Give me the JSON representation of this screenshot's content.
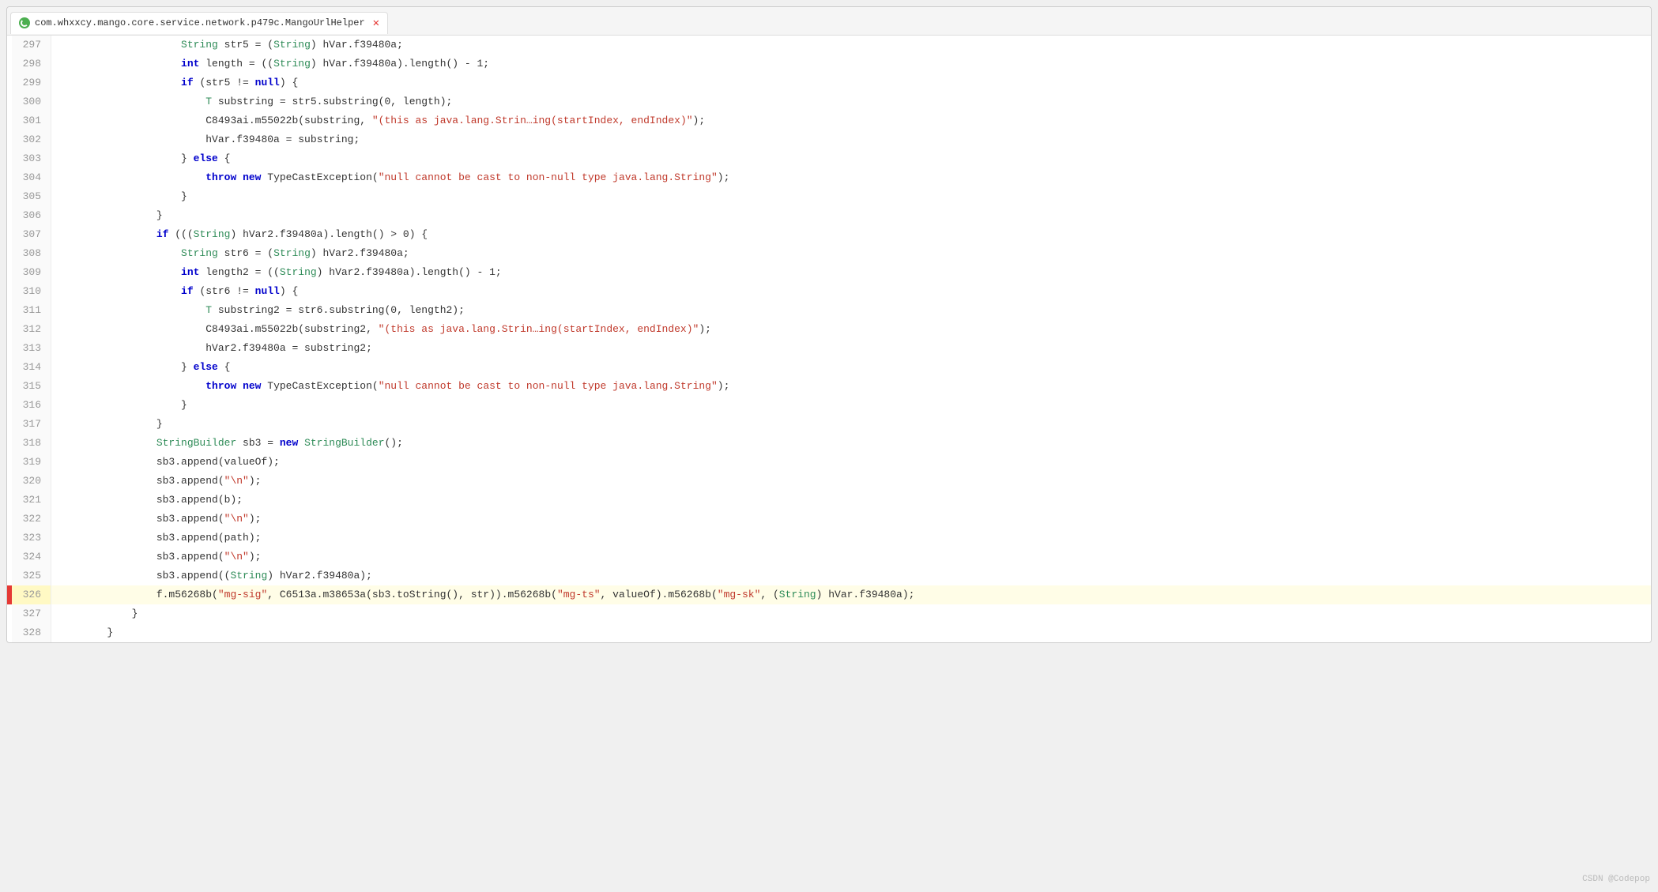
{
  "tab": {
    "icon": "java-icon",
    "label": "com.whxxcy.mango.core.service.network.p479c.MangoUrlHelper",
    "close_label": "✕"
  },
  "lines": [
    {
      "num": "297",
      "indent": 5,
      "tokens": [
        {
          "t": "type",
          "v": "String"
        },
        {
          "t": "var",
          "v": " str5 = ("
        },
        {
          "t": "type",
          "v": "String"
        },
        {
          "t": "var",
          "v": ") hVar.f39480a;"
        }
      ]
    },
    {
      "num": "298",
      "indent": 5,
      "tokens": [
        {
          "t": "kw",
          "v": "int"
        },
        {
          "t": "var",
          "v": " length = (("
        },
        {
          "t": "type",
          "v": "String"
        },
        {
          "t": "var",
          "v": ") hVar.f39480a).length() - 1;"
        }
      ]
    },
    {
      "num": "299",
      "indent": 5,
      "tokens": [
        {
          "t": "kw",
          "v": "if"
        },
        {
          "t": "var",
          "v": " (str5 != "
        },
        {
          "t": "kw",
          "v": "null"
        },
        {
          "t": "var",
          "v": ") {"
        }
      ]
    },
    {
      "num": "300",
      "indent": 6,
      "tokens": [
        {
          "t": "type",
          "v": "T"
        },
        {
          "t": "var",
          "v": " substring = str5.substring(0, length);"
        }
      ]
    },
    {
      "num": "301",
      "indent": 6,
      "tokens": [
        {
          "t": "var",
          "v": "C8493ai.m55022b(substring, "
        },
        {
          "t": "str",
          "v": "\"(this as java.lang.Strin…ing(startIndex, endIndex)\""
        },
        {
          "t": "var",
          "v": ");"
        }
      ]
    },
    {
      "num": "302",
      "indent": 6,
      "tokens": [
        {
          "t": "var",
          "v": "hVar.f39480a = substring;"
        }
      ]
    },
    {
      "num": "303",
      "indent": 5,
      "tokens": [
        {
          "t": "var",
          "v": "} "
        },
        {
          "t": "kw",
          "v": "else"
        },
        {
          "t": "var",
          "v": " {"
        }
      ]
    },
    {
      "num": "304",
      "indent": 6,
      "tokens": [
        {
          "t": "kw",
          "v": "throw"
        },
        {
          "t": "var",
          "v": " "
        },
        {
          "t": "kw-new",
          "v": "new"
        },
        {
          "t": "var",
          "v": " TypeCastException("
        },
        {
          "t": "str",
          "v": "\"null cannot be cast to non-null type java.lang.String\""
        },
        {
          "t": "var",
          "v": ");"
        }
      ]
    },
    {
      "num": "305",
      "indent": 5,
      "tokens": [
        {
          "t": "var",
          "v": "}"
        }
      ]
    },
    {
      "num": "306",
      "indent": 4,
      "tokens": [
        {
          "t": "var",
          "v": "}"
        }
      ]
    },
    {
      "num": "307",
      "indent": 4,
      "tokens": [
        {
          "t": "kw",
          "v": "if"
        },
        {
          "t": "var",
          "v": " ((("
        },
        {
          "t": "type",
          "v": "String"
        },
        {
          "t": "var",
          "v": ") hVar2.f39480a).length() > 0) {"
        }
      ]
    },
    {
      "num": "308",
      "indent": 5,
      "tokens": [
        {
          "t": "type",
          "v": "String"
        },
        {
          "t": "var",
          "v": " str6 = ("
        },
        {
          "t": "type",
          "v": "String"
        },
        {
          "t": "var",
          "v": ") hVar2.f39480a;"
        }
      ]
    },
    {
      "num": "309",
      "indent": 5,
      "tokens": [
        {
          "t": "kw",
          "v": "int"
        },
        {
          "t": "var",
          "v": " length2 = (("
        },
        {
          "t": "type",
          "v": "String"
        },
        {
          "t": "var",
          "v": ") hVar2.f39480a).length() - 1;"
        }
      ]
    },
    {
      "num": "310",
      "indent": 5,
      "tokens": [
        {
          "t": "kw",
          "v": "if"
        },
        {
          "t": "var",
          "v": " (str6 != "
        },
        {
          "t": "kw",
          "v": "null"
        },
        {
          "t": "var",
          "v": ") {"
        }
      ]
    },
    {
      "num": "311",
      "indent": 6,
      "tokens": [
        {
          "t": "type",
          "v": "T"
        },
        {
          "t": "var",
          "v": " substring2 = str6.substring(0, length2);"
        }
      ]
    },
    {
      "num": "312",
      "indent": 6,
      "tokens": [
        {
          "t": "var",
          "v": "C8493ai.m55022b(substring2, "
        },
        {
          "t": "str",
          "v": "\"(this as java.lang.Strin…ing(startIndex, endIndex)\""
        },
        {
          "t": "var",
          "v": ");"
        }
      ]
    },
    {
      "num": "313",
      "indent": 6,
      "tokens": [
        {
          "t": "var",
          "v": "hVar2.f39480a = substring2;"
        }
      ]
    },
    {
      "num": "314",
      "indent": 5,
      "tokens": [
        {
          "t": "var",
          "v": "} "
        },
        {
          "t": "kw",
          "v": "else"
        },
        {
          "t": "var",
          "v": " {"
        }
      ]
    },
    {
      "num": "315",
      "indent": 6,
      "tokens": [
        {
          "t": "kw",
          "v": "throw"
        },
        {
          "t": "var",
          "v": " "
        },
        {
          "t": "kw-new",
          "v": "new"
        },
        {
          "t": "var",
          "v": " TypeCastException("
        },
        {
          "t": "str",
          "v": "\"null cannot be cast to non-null type java.lang.String\""
        },
        {
          "t": "var",
          "v": ");"
        }
      ]
    },
    {
      "num": "316",
      "indent": 5,
      "tokens": [
        {
          "t": "var",
          "v": "}"
        }
      ]
    },
    {
      "num": "317",
      "indent": 4,
      "tokens": [
        {
          "t": "var",
          "v": "}"
        }
      ]
    },
    {
      "num": "318",
      "indent": 4,
      "tokens": [
        {
          "t": "type",
          "v": "StringBuilder"
        },
        {
          "t": "var",
          "v": " sb3 = "
        },
        {
          "t": "kw-new",
          "v": "new"
        },
        {
          "t": "var",
          "v": " "
        },
        {
          "t": "type",
          "v": "StringBuilder"
        },
        {
          "t": "var",
          "v": "();"
        }
      ]
    },
    {
      "num": "319",
      "indent": 4,
      "tokens": [
        {
          "t": "var",
          "v": "sb3.append(valueOf);"
        }
      ]
    },
    {
      "num": "320",
      "indent": 4,
      "tokens": [
        {
          "t": "var",
          "v": "sb3.append("
        },
        {
          "t": "str",
          "v": "\"\\n\""
        },
        {
          "t": "var",
          "v": ");"
        }
      ]
    },
    {
      "num": "321",
      "indent": 4,
      "tokens": [
        {
          "t": "var",
          "v": "sb3.append(b);"
        }
      ]
    },
    {
      "num": "322",
      "indent": 4,
      "tokens": [
        {
          "t": "var",
          "v": "sb3.append("
        },
        {
          "t": "str",
          "v": "\"\\n\""
        },
        {
          "t": "var",
          "v": ");"
        }
      ]
    },
    {
      "num": "323",
      "indent": 4,
      "tokens": [
        {
          "t": "var",
          "v": "sb3.append(path);"
        }
      ]
    },
    {
      "num": "324",
      "indent": 4,
      "tokens": [
        {
          "t": "var",
          "v": "sb3.append("
        },
        {
          "t": "str",
          "v": "\"\\n\""
        },
        {
          "t": "var",
          "v": ");"
        }
      ]
    },
    {
      "num": "325",
      "indent": 4,
      "tokens": [
        {
          "t": "var",
          "v": "sb3.append(("
        },
        {
          "t": "type",
          "v": "String"
        },
        {
          "t": "var",
          "v": ") hVar2.f39480a);"
        }
      ]
    },
    {
      "num": "326",
      "indent": 4,
      "tokens": [
        {
          "t": "var",
          "v": "f.m56268b("
        },
        {
          "t": "str",
          "v": "\"mg-sig\""
        },
        {
          "t": "var",
          "v": ", C6513a.m38653a(sb3.toString(), str)).m56268b("
        },
        {
          "t": "str",
          "v": "\"mg-ts\""
        },
        {
          "t": "var",
          "v": ", valueOf).m56268b("
        },
        {
          "t": "str",
          "v": "\"mg-sk\""
        },
        {
          "t": "var",
          "v": ", ("
        },
        {
          "t": "type",
          "v": "String"
        },
        {
          "t": "var",
          "v": ") hVar.f39480a);"
        }
      ],
      "highlighted": true,
      "marker": true
    },
    {
      "num": "327",
      "indent": 3,
      "tokens": [
        {
          "t": "var",
          "v": "}"
        }
      ]
    },
    {
      "num": "328",
      "indent": 2,
      "tokens": [
        {
          "t": "var",
          "v": "}"
        }
      ]
    }
  ],
  "watermark": "CSDN @Codepop"
}
